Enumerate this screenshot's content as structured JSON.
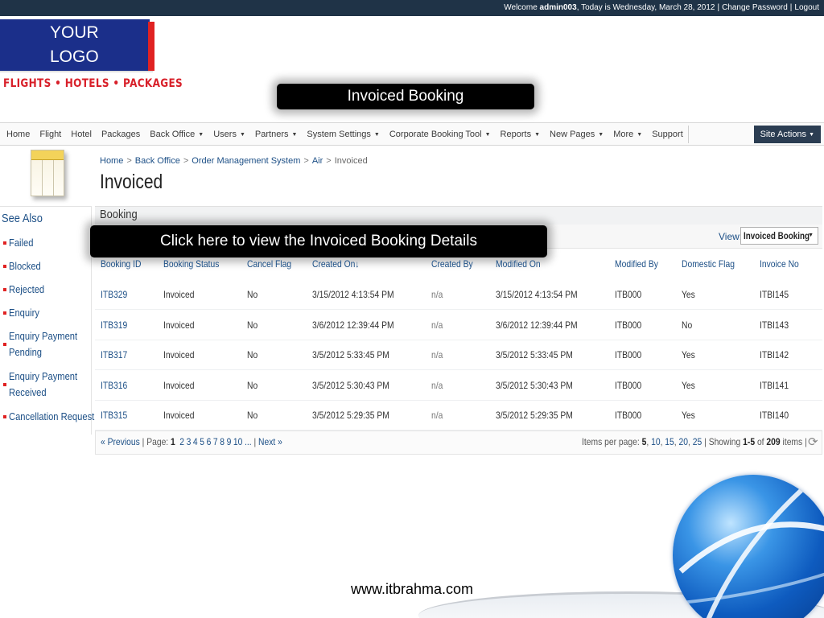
{
  "topbar": {
    "welcome": "Welcome",
    "user": "admin003",
    "date_text": ", Today is Wednesday, March 28, 2012",
    "change_password": "Change Password",
    "logout": "Logout"
  },
  "logo": {
    "line1": "YOUR",
    "line2": "LOGO",
    "tagline": "FLIGHTS • HOTELS • PACKAGES"
  },
  "callouts": {
    "top": "Invoiced Booking",
    "middle": "Click here to view the Invoiced Booking Details"
  },
  "nav": {
    "items": [
      {
        "label": "Home",
        "has_menu": false
      },
      {
        "label": "Flight",
        "has_menu": false
      },
      {
        "label": "Hotel",
        "has_menu": false
      },
      {
        "label": "Packages",
        "has_menu": false
      },
      {
        "label": "Back Office",
        "has_menu": true
      },
      {
        "label": "Users",
        "has_menu": true
      },
      {
        "label": "Partners",
        "has_menu": true
      },
      {
        "label": "System Settings",
        "has_menu": true
      },
      {
        "label": "Corporate Booking Tool",
        "has_menu": true
      },
      {
        "label": "Reports",
        "has_menu": true
      },
      {
        "label": "New Pages",
        "has_menu": true
      },
      {
        "label": "More",
        "has_menu": true
      },
      {
        "label": "Support",
        "has_menu": false
      }
    ],
    "site_actions": "Site Actions"
  },
  "breadcrumb": {
    "items": [
      "Home",
      "Back Office",
      "Order Management System",
      "Air"
    ],
    "current": "Invoiced"
  },
  "page_title": "Invoiced",
  "sidebar": {
    "heading": "See Also",
    "items": [
      {
        "label": "Failed"
      },
      {
        "label": "Blocked"
      },
      {
        "label": "Rejected"
      },
      {
        "label": "Enquiry"
      },
      {
        "label": "Enquiry Payment Pending",
        "line1": "Enquiry Payment",
        "line2": "Pending"
      },
      {
        "label": "Enquiry Payment Received",
        "line1": "Enquiry Payment",
        "line2": "Received"
      },
      {
        "label": "Cancellation Request"
      }
    ]
  },
  "section": {
    "title": "Booking",
    "view_label": "View:",
    "view_selected": "Invoiced Booking"
  },
  "table": {
    "columns": [
      "Booking ID",
      "Booking Status",
      "Cancel Flag",
      "Created On↓",
      "Created By",
      "Modified On",
      "Modified By",
      "Domestic Flag",
      "Invoice No"
    ],
    "rows": [
      [
        "ITB329",
        "Invoiced",
        "No",
        "3/15/2012 4:13:54 PM",
        "n/a",
        "3/15/2012 4:13:54 PM",
        "ITB000",
        "Yes",
        "ITBI145"
      ],
      [
        "ITB319",
        "Invoiced",
        "No",
        "3/6/2012 12:39:44 PM",
        "n/a",
        "3/6/2012 12:39:44 PM",
        "ITB000",
        "No",
        "ITBI143"
      ],
      [
        "ITB317",
        "Invoiced",
        "No",
        "3/5/2012 5:33:45 PM",
        "n/a",
        "3/5/2012 5:33:45 PM",
        "ITB000",
        "Yes",
        "ITBI142"
      ],
      [
        "ITB316",
        "Invoiced",
        "No",
        "3/5/2012 5:30:43 PM",
        "n/a",
        "3/5/2012 5:30:43 PM",
        "ITB000",
        "Yes",
        "ITBI141"
      ],
      [
        "ITB315",
        "Invoiced",
        "No",
        "3/5/2012 5:29:35 PM",
        "n/a",
        "3/5/2012 5:29:35 PM",
        "ITB000",
        "Yes",
        "ITBI140"
      ]
    ]
  },
  "pager": {
    "previous": "« Previous",
    "page_label": "Page:",
    "current_page": "1",
    "pages": [
      "2",
      "3",
      "4",
      "5",
      "6",
      "7",
      "8",
      "9",
      "10",
      "..."
    ],
    "next": "Next »",
    "items_per_page_label": "Items per page:",
    "per_page_current": "5",
    "per_page_options": [
      "10",
      "15",
      "20",
      "25"
    ],
    "showing_label": "Showing",
    "showing_range": "1-5",
    "of_label": "of",
    "total": "209",
    "items_label": "items"
  },
  "footer": {
    "url": "www.itbrahma.com"
  },
  "colors": {
    "topbar": "#1f3347",
    "logo_bg": "#1b2f8a",
    "brand_red": "#d8202a",
    "link": "#1c4f86",
    "site_actions": "#2b3d52"
  }
}
